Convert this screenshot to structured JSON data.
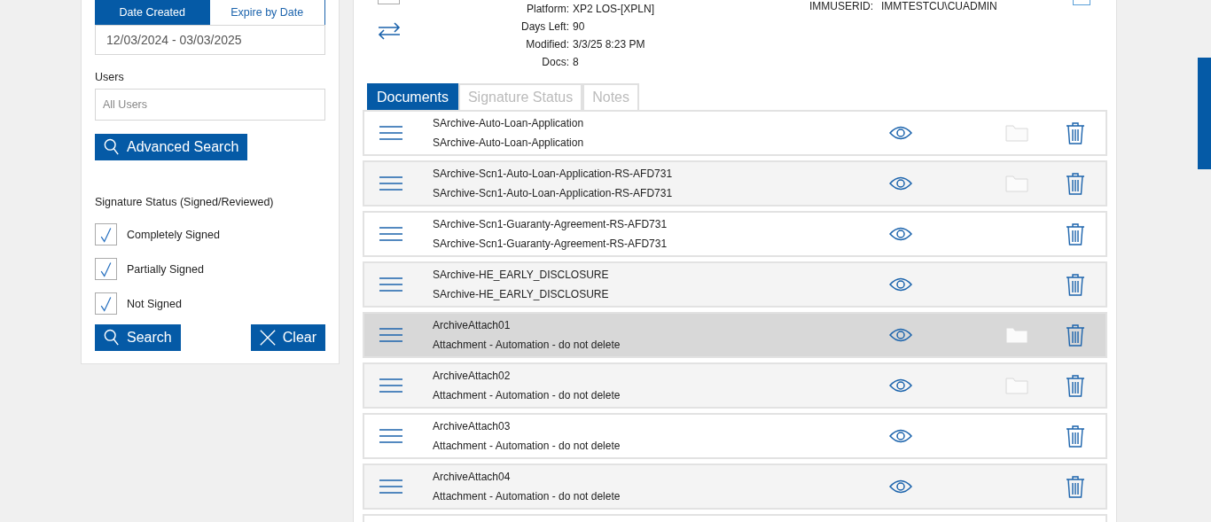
{
  "filter_panel": {
    "date_tabs": [
      {
        "label": "Date Created",
        "selected": true
      },
      {
        "label": "Expire by Date",
        "selected": false
      }
    ],
    "date_range": "12/03/2024 - 03/03/2025",
    "users_label": "Users",
    "users_placeholder": "All Users",
    "advanced_search": "Advanced Search",
    "signature_status_label": "Signature Status (Signed/Reviewed)",
    "statuses": [
      {
        "label": "Completely Signed",
        "checked": true
      },
      {
        "label": "Partially Signed",
        "checked": true
      },
      {
        "label": "Not Signed",
        "checked": true
      }
    ],
    "search": "Search",
    "clear": "Clear"
  },
  "details": {
    "fields": [
      {
        "label": "Platform:",
        "value": "XP2 LOS-[XPLN]"
      },
      {
        "label": "Days Left:",
        "value": "90"
      },
      {
        "label": "Modified:",
        "value": "3/3/25 8:23 PM"
      },
      {
        "label": "Docs:",
        "value": "8"
      }
    ],
    "header_checkboxes": [
      {
        "checked": false
      },
      {
        "checked": false
      }
    ],
    "user_label": "IMMUSERID:",
    "user_value": "IMMTESTCU\\CUADMIN"
  },
  "tabs": [
    {
      "label": "Documents",
      "selected": true
    },
    {
      "label": "Signature Status",
      "selected": false
    },
    {
      "label": "Notes",
      "selected": false
    }
  ],
  "documents": [
    {
      "name": "SArchive-Auto-Loan-Application",
      "description": "SArchive-Auto-Loan-Application",
      "has_folder": true,
      "selected": false
    },
    {
      "name": "SArchive-Scn1-Auto-Loan-Application-RS-AFD731",
      "description": "SArchive-Scn1-Auto-Loan-Application-RS-AFD731",
      "has_folder": true,
      "selected": false
    },
    {
      "name": "SArchive-Scn1-Guaranty-Agreement-RS-AFD731",
      "description": "SArchive-Scn1-Guaranty-Agreement-RS-AFD731",
      "has_folder": false,
      "selected": false
    },
    {
      "name": "SArchive-HE_EARLY_DISCLOSURE",
      "description": "SArchive-HE_EARLY_DISCLOSURE",
      "has_folder": false,
      "selected": false
    },
    {
      "name": "ArchiveAttach01",
      "description": "Attachment - Automation - do not delete",
      "has_folder": true,
      "selected": true
    },
    {
      "name": "ArchiveAttach02",
      "description": "Attachment - Automation - do not delete",
      "has_folder": true,
      "selected": false
    },
    {
      "name": "ArchiveAttach03",
      "description": "Attachment - Automation - do not delete",
      "has_folder": false,
      "selected": false
    },
    {
      "name": "ArchiveAttach04",
      "description": "Attachment - Automation - do not delete",
      "has_folder": false,
      "selected": false
    }
  ]
}
